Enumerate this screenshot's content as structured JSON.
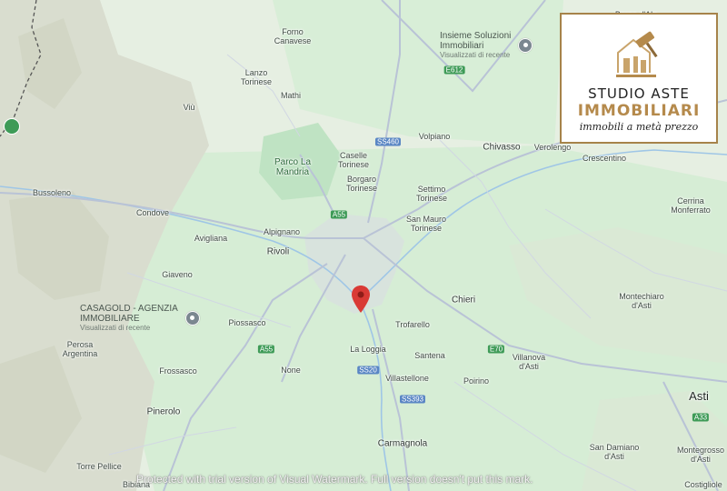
{
  "map": {
    "places": [
      {
        "name": "Forno\nCanavese",
        "cls": ""
      },
      {
        "name": "Lanzo\nTorinese",
        "cls": ""
      },
      {
        "name": "Mathi",
        "cls": ""
      },
      {
        "name": "Viù",
        "cls": ""
      },
      {
        "name": "Borgo d'Ale",
        "cls": ""
      },
      {
        "name": "Volpiano",
        "cls": ""
      },
      {
        "name": "Chivasso",
        "cls": "city"
      },
      {
        "name": "Verolengo",
        "cls": ""
      },
      {
        "name": "Crescentino",
        "cls": ""
      },
      {
        "name": "Parco La\nMandria",
        "cls": "green"
      },
      {
        "name": "Caselle\nTorinese",
        "cls": ""
      },
      {
        "name": "Borgaro\nTorinese",
        "cls": ""
      },
      {
        "name": "Settimo\nTorinese",
        "cls": ""
      },
      {
        "name": "Bussoleno",
        "cls": ""
      },
      {
        "name": "Condove",
        "cls": ""
      },
      {
        "name": "Avigliana",
        "cls": ""
      },
      {
        "name": "Alpignano",
        "cls": ""
      },
      {
        "name": "Rivoli",
        "cls": "city"
      },
      {
        "name": "San Mauro\nTorinese",
        "cls": ""
      },
      {
        "name": "Cerrina\nMonferrato",
        "cls": ""
      },
      {
        "name": "Giaveno",
        "cls": ""
      },
      {
        "name": "Chieri",
        "cls": "city"
      },
      {
        "name": "Montechiaro\nd'Asti",
        "cls": ""
      },
      {
        "name": "Piossasco",
        "cls": ""
      },
      {
        "name": "Trofarello",
        "cls": ""
      },
      {
        "name": "Perosa\nArgentina",
        "cls": ""
      },
      {
        "name": "La Loggia",
        "cls": ""
      },
      {
        "name": "Santena",
        "cls": ""
      },
      {
        "name": "Villanova\nd'Asti",
        "cls": ""
      },
      {
        "name": "Frossasco",
        "cls": ""
      },
      {
        "name": "None",
        "cls": ""
      },
      {
        "name": "Villastellone",
        "cls": ""
      },
      {
        "name": "Poirino",
        "cls": ""
      },
      {
        "name": "Asti",
        "cls": "big"
      },
      {
        "name": "Pinerolo",
        "cls": "city"
      },
      {
        "name": "Carmagnola",
        "cls": "city"
      },
      {
        "name": "Torre Pellice",
        "cls": ""
      },
      {
        "name": "San Damiano\nd'Asti",
        "cls": ""
      },
      {
        "name": "Montegrosso\nd'Asti",
        "cls": ""
      },
      {
        "name": "Bibiana",
        "cls": ""
      },
      {
        "name": "Costigliole",
        "cls": ""
      }
    ],
    "shields": [
      {
        "label": "E612",
        "color": "green"
      },
      {
        "label": "SS460",
        "color": "blue"
      },
      {
        "label": "A55",
        "color": "green"
      },
      {
        "label": "A55",
        "color": "green"
      },
      {
        "label": "E70",
        "color": "green"
      },
      {
        "label": "SS20",
        "color": "blue"
      },
      {
        "label": "SS393",
        "color": "blue"
      },
      {
        "label": "A33",
        "color": "green"
      }
    ],
    "pois": [
      {
        "title": "Insieme Soluzioni\nImmobiliari",
        "subtitle": "Visualizzati di recente",
        "icon": "place-icon"
      },
      {
        "title": "CASAGOLD - AGENZIA\nIMMOBILIARE",
        "subtitle": "Visualizzati di recente",
        "icon": "place-icon"
      }
    ]
  },
  "logo": {
    "line1": "STUDIO ASTE",
    "line2": "IMMOBILIARI",
    "tagline": "immobili a metà prezzo",
    "icon": "gavel-house-icon",
    "gold": "#b58a4c"
  },
  "watermark": "Protected with trial version of Visual Watermark. Full version doesn't put this mark.",
  "colors": {
    "background": "#e6efe2",
    "roads": "#b9c3d6",
    "pin": "#d93a35"
  }
}
